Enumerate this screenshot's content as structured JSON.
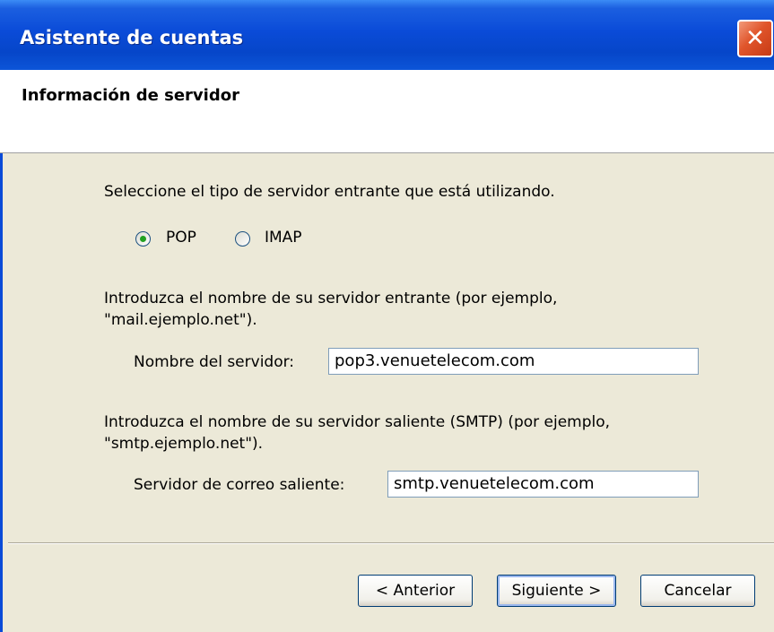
{
  "window": {
    "title": "Asistente de cuentas",
    "close_icon": "close-icon",
    "accent_color": "#0a4bd8",
    "close_color": "#e0552b"
  },
  "header": {
    "title": "Información de servidor"
  },
  "content": {
    "server_type_prompt": "Seleccione el tipo de servidor entrante que está utilizando.",
    "server_type_options": [
      {
        "label": "POP",
        "selected": true
      },
      {
        "label": "IMAP",
        "selected": false
      }
    ],
    "incoming_prompt_line1": "Introduzca el nombre de su servidor entrante (por ejemplo,",
    "incoming_prompt_line2": "\"mail.ejemplo.net\").",
    "incoming_label": "Nombre del servidor:",
    "incoming_value": "pop3.venuetelecom.com",
    "outgoing_prompt_line1": "Introduzca el nombre de su servidor saliente (SMTP) (por ejemplo,",
    "outgoing_prompt_line2": "\"smtp.ejemplo.net\").",
    "outgoing_label": "Servidor de correo saliente:",
    "outgoing_value": "smtp.venuetelecom.com"
  },
  "buttons": {
    "back": "< Anterior",
    "next": "Siguiente >",
    "cancel": "Cancelar"
  }
}
